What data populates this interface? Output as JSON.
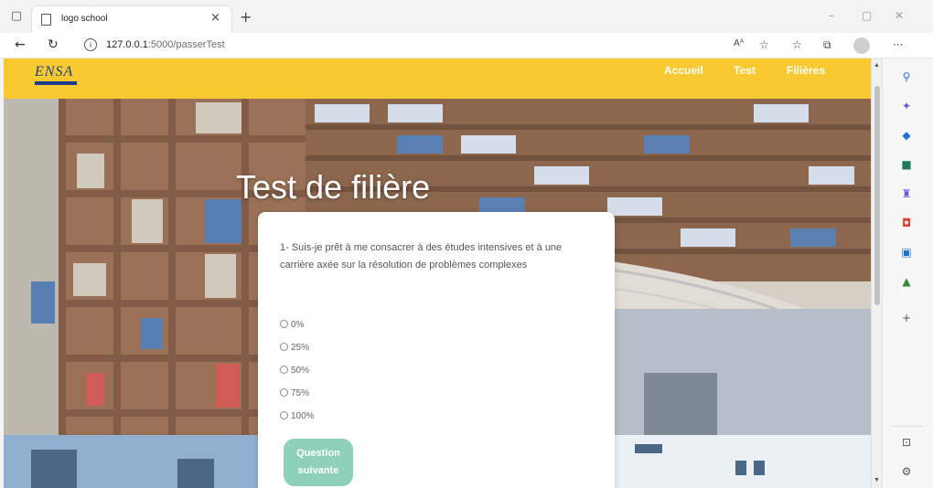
{
  "browser": {
    "tab_title": "logo school",
    "tab_close": "×",
    "new_tab": "+",
    "url_host": "127.0.0.1",
    "url_path": ":5000/passerTest",
    "reader_mode": "Aᵃ",
    "icons": {
      "sidebar_toggle": "sidebar-toggle-icon",
      "back": "back-arrow-icon",
      "refresh": "refresh-icon",
      "info": "info-icon",
      "favorites": "favorites-icon",
      "collections": "collections-icon",
      "profile": "profile-icon",
      "more": "more-icon"
    }
  },
  "site": {
    "nav": {
      "logo_text": "ENSA",
      "links": [
        "Accueil",
        "Test",
        "Filières"
      ]
    },
    "hero_title": "Test de filière",
    "question": "1- Suis-je prêt à me consacrer à des études intensives et à une carrière axée sur la résolution de problèmes complexes",
    "options": [
      "0%",
      "25%",
      "50%",
      "75%",
      "100%"
    ],
    "next_button": "Question suivante"
  },
  "sidebar": {
    "icons": [
      "search-icon",
      "copilot-icon",
      "shopping-tag-icon",
      "toolbox-icon",
      "games-icon",
      "office-icon",
      "outlook-icon",
      "tree-icon",
      "add-icon",
      "split-screen-icon",
      "settings-icon"
    ]
  },
  "colors": {
    "navbar": "#f9c931",
    "button": "#8fd1b8",
    "text_dark": "#555555",
    "hero_text": "#ffffff"
  }
}
